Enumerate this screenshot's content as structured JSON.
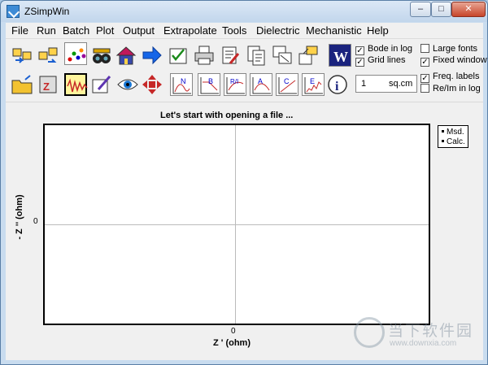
{
  "window": {
    "title": "ZSimpWin",
    "min_label": "–",
    "max_label": "□",
    "close_label": "✕"
  },
  "menu": [
    "File",
    "Run",
    "Batch",
    "Plot",
    "Output",
    "Extrapolate",
    "Tools",
    "Dielectric",
    "Mechanistic",
    "Help"
  ],
  "toolbar_icons": {
    "row1": [
      "open-files-icon",
      "open-files-2-icon",
      "scatter-data-icon",
      "binoculars-icon",
      "house-icon",
      "right-arrow-icon",
      "checklist-icon",
      "printer-icon",
      "edit-document-icon",
      "documents-icon",
      "copy-window-icon",
      "paste-folder-icon",
      "word-icon"
    ],
    "row2": [
      "open-folder-icon",
      "zip-icon",
      "waveform-icon",
      "pen-edit-icon",
      "eye-icon",
      "move-arrows-icon",
      "nyquist-plot-icon",
      "bode-plot-icon",
      "real-imag-plot-icon",
      "admittance-plot-icon",
      "capacitance-plot-icon",
      "modulus-plot-icon",
      "info-icon"
    ]
  },
  "toolbar_letters": {
    "w": "W",
    "n": "N",
    "b": "B",
    "ri": "R/I",
    "a": "A",
    "c": "C",
    "e": "E",
    "i": "i"
  },
  "options": {
    "bode_in_log": {
      "label": "Bode in log",
      "checked": true
    },
    "grid_lines": {
      "label": "Grid lines",
      "checked": true
    },
    "large_fonts": {
      "label": "Large fonts",
      "checked": false
    },
    "fixed_window": {
      "label": "Fixed window",
      "checked": true
    },
    "freq_labels": {
      "label": "Freq. labels",
      "checked": true
    },
    "re_im_in_log": {
      "label": "Re/Im in log",
      "checked": false
    }
  },
  "area": {
    "value": "1",
    "unit": "sq.cm"
  },
  "plot": {
    "title": "Let's start with opening a file ...",
    "xlabel": "Z '  (ohm)",
    "ylabel": "- Z ''  (ohm)",
    "xtick": "0",
    "ytick": "0",
    "legend": {
      "measured": "Msd.",
      "calculated": "Calc."
    }
  },
  "watermark": {
    "text": "当下软件园",
    "url": "www.downxia.com"
  }
}
